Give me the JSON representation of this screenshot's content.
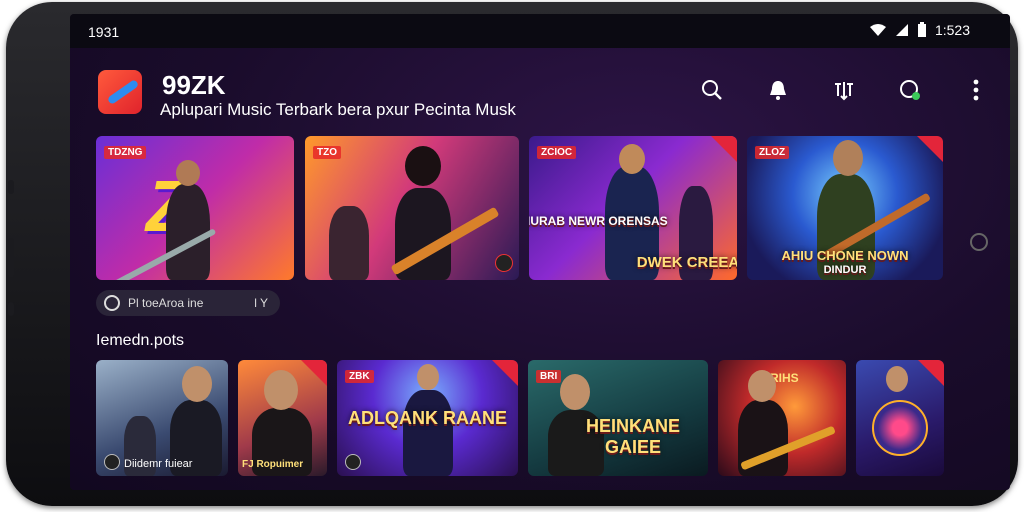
{
  "status": {
    "left_time": "1931",
    "right_time": "1:523"
  },
  "app": {
    "name": "99ZK",
    "subtitle": "Aplupari Music Terbark bera pxur Pecinta Musk"
  },
  "icons": {
    "search": "search-icon",
    "bell": "bell-icon",
    "cast": "cast-icon",
    "profile": "profile-icon",
    "menu": "more-vert-icon"
  },
  "featured": [
    {
      "badge": "TDZNG",
      "caption": ""
    },
    {
      "badge": "TZO",
      "caption": ""
    },
    {
      "badge": "ZCIOC",
      "caption": "DIURAB NEWR ORENSAS",
      "caption2": "DWEK CREEAS"
    },
    {
      "badge": "ZLOZ",
      "caption": "AHIU CHONE NOWN",
      "caption2": "DINDUR"
    }
  ],
  "chip": {
    "label": "Pl toeAroa ine",
    "suffix": "l Y"
  },
  "section": {
    "title": "Iemedn.pots"
  },
  "tracks": [
    {
      "badge": "",
      "caption": "Diidemr fuiear"
    },
    {
      "badge": "",
      "caption": "FJ  Ropuimer"
    },
    {
      "badge": "ZBK",
      "caption": "ADLQANK RAANE"
    },
    {
      "badge": "BRI",
      "caption": "HEINKANE GAIEE"
    },
    {
      "badge": "RIHS",
      "caption": ""
    },
    {
      "badge": "",
      "caption": ""
    }
  ],
  "colors": {
    "accent": "#e3253a",
    "background": "#1a0c2b",
    "text": "#ffffff"
  }
}
